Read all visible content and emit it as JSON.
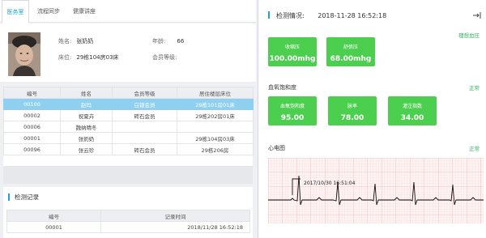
{
  "tabs": [
    {
      "label": "医务室",
      "active": true
    },
    {
      "label": "流程同步",
      "active": false
    },
    {
      "label": "健康讲座",
      "active": false
    }
  ],
  "patient": {
    "name_label": "姓名:",
    "name_value": "张奶奶",
    "age_label": "年龄:",
    "age_value": "66",
    "bed_label": "床位:",
    "bed_value": "29栋104房03床",
    "member_label": "会员等级:",
    "member_value": ""
  },
  "member_table": {
    "headers": [
      "编号",
      "姓名",
      "会员等级",
      "居住楼层床位"
    ],
    "rows": [
      {
        "cells": [
          "00100",
          "赵玛",
          "白银会员",
          "29栋101房01床"
        ],
        "selected": true
      },
      {
        "cells": [
          "00002",
          "祝夏卉",
          "砖石会员",
          "29栋202房01床"
        ],
        "selected": false
      },
      {
        "cells": [
          "00006",
          "魏纳晴冬",
          "",
          ""
        ],
        "selected": false
      },
      {
        "cells": [
          "00001",
          "张奶奶",
          "",
          "29栋104房03床"
        ],
        "selected": false
      },
      {
        "cells": [
          "00096",
          "张云珍",
          "砖石会员",
          "29栋206房"
        ],
        "selected": false
      }
    ]
  },
  "records": {
    "title": "检测记录",
    "headers": [
      "编号",
      "记录时间"
    ],
    "rows": [
      [
        "00001",
        "2018/11/28 16:52:18"
      ]
    ]
  },
  "detection": {
    "title": "检测情况:",
    "datetime": "2018-11-28 16:52:18",
    "bp_status": "理想血压",
    "bp_cards": [
      {
        "label": "收缩压",
        "value": "100.00mhg"
      },
      {
        "label": "舒張压",
        "value": "68.00mhg"
      }
    ],
    "oxygen_label": "血氧饱和度",
    "oxygen_status": "正常",
    "oxygen_cards": [
      {
        "label": "血氧饱和度",
        "value": "95.00"
      },
      {
        "label": "脉率",
        "value": "78.00"
      },
      {
        "label": "灌注指数",
        "value": "34.00"
      }
    ],
    "ecg_label": "心电图",
    "ecg_status": "正常",
    "ecg_timestamp": "2017/10/30 16:51:04"
  },
  "colors": {
    "accent": "#1ea0dd",
    "card_green": "#4ccf4e",
    "status_green": "#2fb65a",
    "ecg_grid": "#f2b9b9",
    "selected_row": "#8fd0f1"
  }
}
